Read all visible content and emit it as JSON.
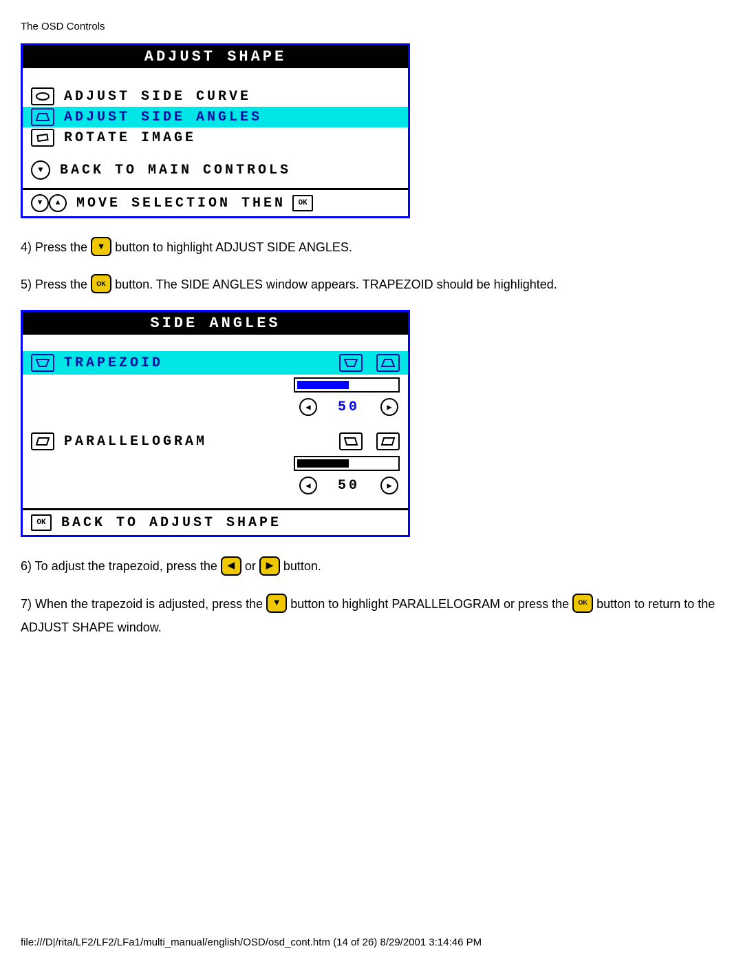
{
  "header": "The OSD Controls",
  "osd1": {
    "title": "ADJUST SHAPE",
    "items": [
      {
        "label": "ADJUST SIDE CURVE",
        "highlight": false
      },
      {
        "label": "ADJUST SIDE ANGLES",
        "highlight": true
      },
      {
        "label": "ROTATE IMAGE",
        "highlight": false
      }
    ],
    "back": "BACK TO MAIN CONTROLS",
    "footer": "MOVE SELECTION THEN",
    "footer_ok": "OK"
  },
  "step4": {
    "pre": "4) Press the ",
    "post": " button to highlight ADJUST SIDE ANGLES."
  },
  "step5": {
    "pre": "5) Press the ",
    "post": " button. The SIDE ANGLES window appears. TRAPEZOID should be highlighted."
  },
  "osd2": {
    "title": "SIDE ANGLES",
    "sections": [
      {
        "name": "TRAPEZOID",
        "value": "50",
        "fill_pct": 50,
        "highlight": true
      },
      {
        "name": "PARALLELOGRAM",
        "value": "50",
        "fill_pct": 50,
        "highlight": false
      }
    ],
    "footer": "BACK TO ADJUST SHAPE",
    "footer_ok": "OK"
  },
  "step6": {
    "pre": "6) To adjust the trapezoid, press the ",
    "mid": " or ",
    "post": " button."
  },
  "step7": {
    "pre": "7) When the trapezoid is adjusted, press the ",
    "mid": " button to highlight PARALLELOGRAM or press the ",
    "post": " button to return to the ADJUST SHAPE window."
  },
  "footer_path": "file:///D|/rita/LF2/LF2/LFa1/multi_manual/english/OSD/osd_cont.htm (14 of 26) 8/29/2001 3:14:46 PM"
}
